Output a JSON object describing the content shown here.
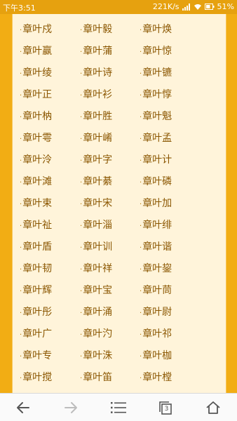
{
  "status_bar": {
    "time": "下午3:51",
    "network_speed": "221K/s",
    "battery": "51%"
  },
  "names": [
    [
      "章叶戍",
      "章叶毅",
      "章叶焕"
    ],
    [
      "章叶赢",
      "章叶蒲",
      "章叶惊"
    ],
    [
      "章叶绫",
      "章叶诗",
      "章叶镳"
    ],
    [
      "章叶正",
      "章叶衫",
      "章叶惇"
    ],
    [
      "章叶枘",
      "章叶胜",
      "章叶魁"
    ],
    [
      "章叶雩",
      "章叶崤",
      "章叶孟"
    ],
    [
      "章叶泠",
      "章叶字",
      "章叶计"
    ],
    [
      "章叶滩",
      "章叶綦",
      "章叶磷"
    ],
    [
      "章叶束",
      "章叶宋",
      "章叶加"
    ],
    [
      "章叶祉",
      "章叶淄",
      "章叶绯"
    ],
    [
      "章叶盾",
      "章叶训",
      "章叶谐"
    ],
    [
      "章叶韧",
      "章叶祥",
      "章叶鋆"
    ],
    [
      "章叶辉",
      "章叶宝",
      "章叶茼"
    ],
    [
      "章叶彤",
      "章叶涌",
      "章叶尉"
    ],
    [
      "章叶广",
      "章叶汋",
      "章叶祁"
    ],
    [
      "章叶专",
      "章叶洙",
      "章叶枷"
    ],
    [
      "章叶搅",
      "章叶笛",
      "章叶樘"
    ]
  ],
  "bullet": "·",
  "bottom_nav": {
    "tab_count": "3",
    "icons": [
      "back-arrow-icon",
      "forward-arrow-icon",
      "menu-icon",
      "tabs-icon",
      "home-icon"
    ]
  },
  "colors": {
    "frame": "#f2ad14",
    "content_bg": "#fff4da",
    "text": "#8a5600"
  }
}
